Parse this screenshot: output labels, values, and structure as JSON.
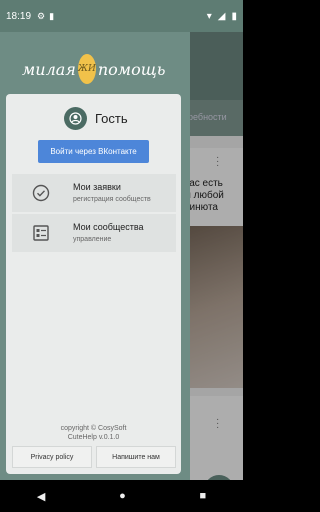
{
  "status_bar": {
    "time": "18:19"
  },
  "logo": {
    "left_text": "милая",
    "right_text": "помощь",
    "seal_text": "ЖИ"
  },
  "background": {
    "tab_text": "ребности",
    "card_text_lines": [
      "вас есть",
      "м любой",
      "ринюта"
    ]
  },
  "drawer": {
    "user": {
      "name": "Гость"
    },
    "vk_button_label": "Войти через ВКонтакте",
    "menu": [
      {
        "title": "Мои заявки",
        "subtitle": "регистрация сообществ"
      },
      {
        "title": "Мои сообщества",
        "subtitle": "управление"
      }
    ],
    "copyright": "copyright © CosySoft",
    "version": "CuteHelp v.0.1.0",
    "privacy_label": "Privacy policy",
    "contact_label": "Напишите нам"
  },
  "colors": {
    "drawer_bg": "#6e8c84",
    "vk_button": "#4d86d9",
    "accent": "#4b6b63"
  }
}
